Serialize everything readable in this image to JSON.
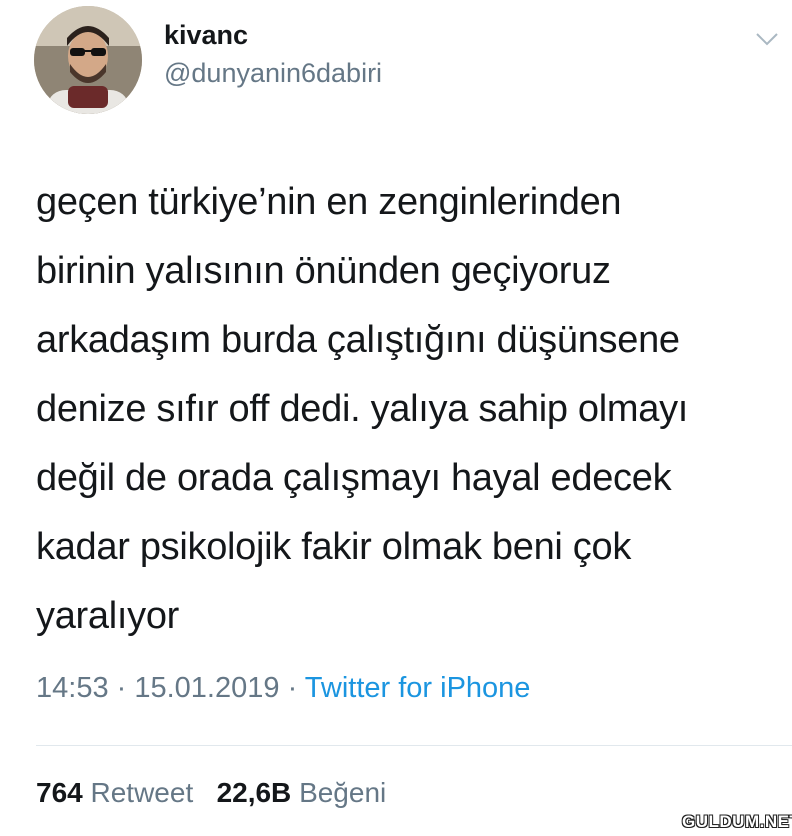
{
  "user": {
    "display_name": "kivanc",
    "handle": "@dunyanin6dabiri"
  },
  "menu_icon": "chevron-down-icon",
  "tweet": {
    "lines": [
      "geçen türkiye’nin en zenginlerinden",
      "birinin yalısının önünden geçiyoruz",
      "arkadaşım burda çalıştığını düşünsene",
      "denize sıfır off dedi. yalıya sahip olmayı",
      "değil de orada çalışmayı hayal edecek",
      "kadar psikolojik fakir olmak beni çok",
      "yaralıyor"
    ],
    "time": "14:53",
    "separator": " · ",
    "date": "15.01.2019",
    "source": "Twitter for iPhone"
  },
  "stats": {
    "retweet_count": "764",
    "retweet_label": "Retweet",
    "like_count": "22,6B",
    "like_label": "Beğeni"
  },
  "watermark": "GULDUM.NET",
  "colors": {
    "text": "#14171a",
    "secondary": "#657786",
    "link": "#1b95e0",
    "divider": "#e1e8ed"
  }
}
